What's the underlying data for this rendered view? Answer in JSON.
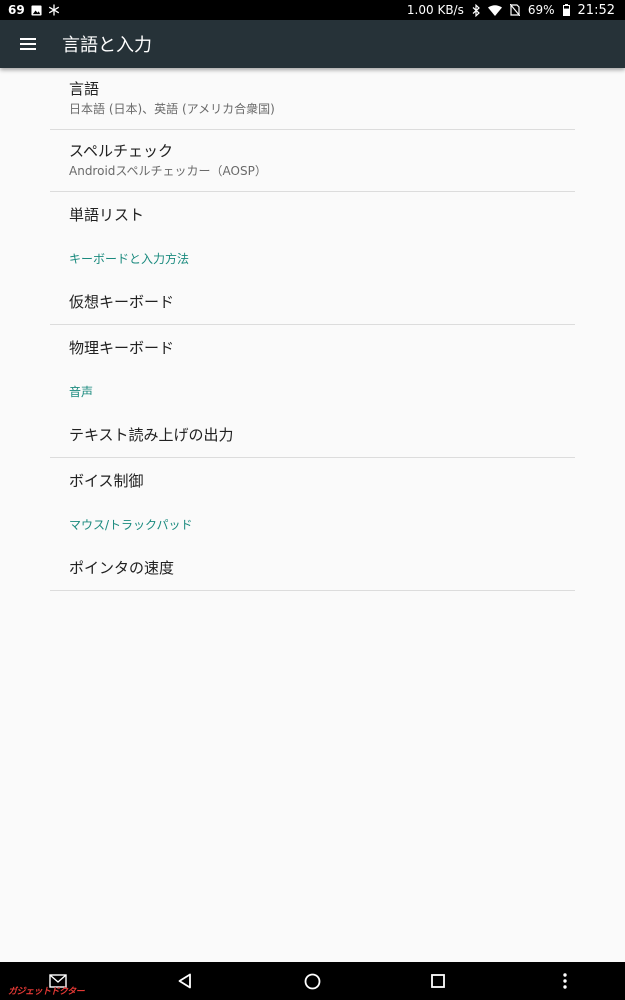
{
  "status_bar": {
    "notification_count": "69",
    "network_speed": "1.00 KB/s",
    "battery_percent": "69%",
    "time": "21:52",
    "icons": [
      "image-icon",
      "snowflake-icon",
      "bluetooth-icon",
      "wifi-icon",
      "no-sim-icon",
      "battery-icon"
    ]
  },
  "app_bar": {
    "title": "言語と入力",
    "menu_icon": "hamburger-menu-icon"
  },
  "settings": {
    "language": {
      "title": "言語",
      "summary": "日本語 (日本)、英語 (アメリカ合衆国)"
    },
    "spell_check": {
      "title": "スペルチェック",
      "summary": "Androidスペルチェッカー（AOSP）"
    },
    "word_list": {
      "title": "単語リスト"
    },
    "keyboard_category": "キーボードと入力方法",
    "virtual_keyboard": {
      "title": "仮想キーボード"
    },
    "physical_keyboard": {
      "title": "物理キーボード"
    },
    "speech_category": "音声",
    "tts_output": {
      "title": "テキスト読み上げの出力"
    },
    "voice_control": {
      "title": "ボイス制御"
    },
    "mouse_category": "マウス/トラックパッド",
    "pointer_speed": {
      "title": "ポインタの速度"
    }
  },
  "nav_bar": {
    "icons": [
      "mail-icon",
      "back-icon",
      "home-icon",
      "recents-icon",
      "more-icon"
    ],
    "watermark": "ガジェットドクター"
  },
  "colors": {
    "app_bar": "#263238",
    "category_accent": "#1a8a7e",
    "background": "#fafafa"
  }
}
